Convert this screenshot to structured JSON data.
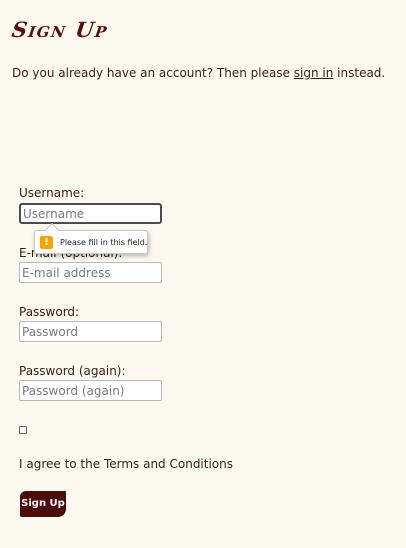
{
  "page": {
    "title": "Sign Up",
    "intro_before": "Do you already have an account? Then please ",
    "intro_link": "sign in",
    "intro_after": " instead."
  },
  "form": {
    "username": {
      "label": "Username:",
      "placeholder": "Username",
      "value": ""
    },
    "email": {
      "label": "E-mail (optional):",
      "placeholder": "E-mail address",
      "value": ""
    },
    "password": {
      "label": "Password:",
      "placeholder": "Password",
      "value": ""
    },
    "password_again": {
      "label": "Password (again):",
      "placeholder": "Password (again)",
      "value": ""
    },
    "terms": {
      "label": "I agree to the Terms and Conditions",
      "checked": false
    },
    "submit_label": "Sign Up"
  },
  "validation_tooltip": {
    "icon": "warning-icon",
    "icon_glyph": "!",
    "message": "Please fill in this field."
  },
  "colors": {
    "background": "#fbf9ef",
    "title": "#5a0f0f",
    "button": "#4d0a0a",
    "warning": "#f5a500"
  }
}
